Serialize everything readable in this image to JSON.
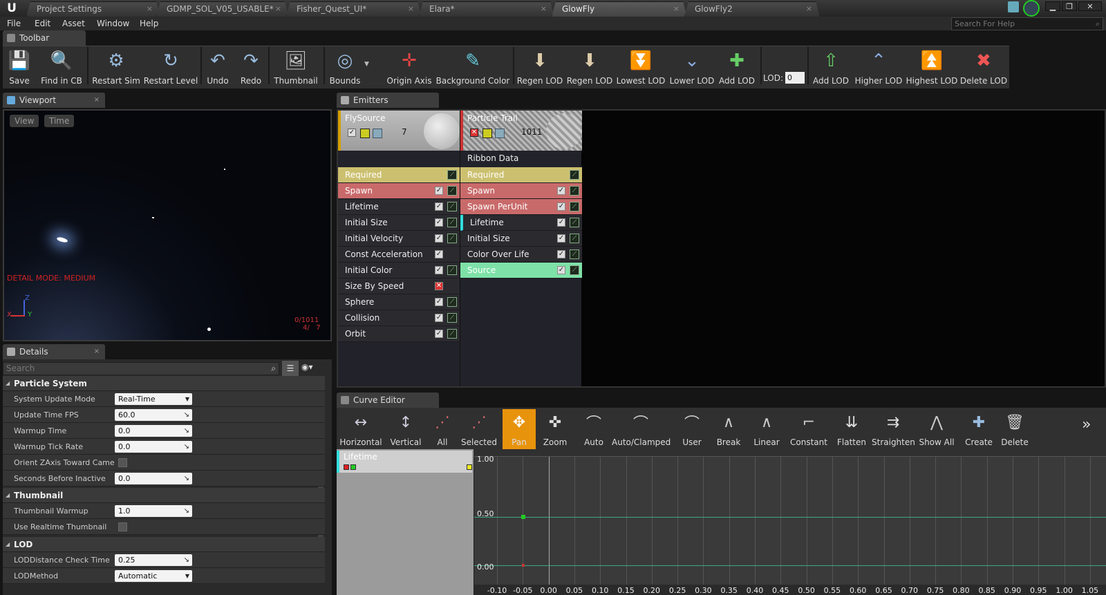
{
  "titlebar": {
    "logo": "U",
    "tabs": [
      "Project Settings",
      "GDMP_SOL_V05_USABLE*",
      "Fisher_Quest_UI*",
      "Elara*",
      "GlowFly",
      "GlowFly2"
    ],
    "close_glyph": "×"
  },
  "menu": [
    "File",
    "Edit",
    "Asset",
    "Window",
    "Help"
  ],
  "help_search_placeholder": "Search For Help",
  "toolbar": {
    "tab_label": "Toolbar",
    "buttons": [
      "Save",
      "Find in CB",
      "Restart Sim",
      "Restart Level",
      "Undo",
      "Redo",
      "Thumbnail",
      "Bounds",
      "Origin Axis",
      "Background Color",
      "Regen LOD",
      "Regen LOD",
      "Lowest LOD",
      "Lower LOD",
      "Add LOD",
      "Add LOD",
      "Higher LOD",
      "Highest LOD",
      "Delete LOD"
    ],
    "lod_label": "LOD:",
    "lod_value": "0"
  },
  "viewport": {
    "tab_label": "Viewport",
    "view_btn": "View",
    "time_btn": "Time",
    "detail_mode": "DETAIL MODE: MEDIUM",
    "counter1": "0/1011",
    "counter2": "4/   7",
    "axis_x": "X",
    "axis_y": "Y",
    "axis_z": "Z"
  },
  "details": {
    "tab_label": "Details",
    "search_placeholder": "Search",
    "cat_particle": "Particle System",
    "cat_thumb": "Thumbnail",
    "cat_lod": "LOD",
    "rows": [
      {
        "k": "System Update Mode",
        "v": "Real-Time"
      },
      {
        "k": "Update Time FPS",
        "v": "60.0"
      },
      {
        "k": "Warmup Time",
        "v": "0.0"
      },
      {
        "k": "Warmup Tick Rate",
        "v": "0.0"
      },
      {
        "k": "Orient ZAxis Toward Camera",
        "v": ""
      },
      {
        "k": "Seconds Before Inactive",
        "v": "0.0"
      },
      {
        "k": "Thumbnail Warmup",
        "v": "1.0"
      },
      {
        "k": "Use Realtime Thumbnail",
        "v": ""
      },
      {
        "k": "LODDistance Check Time",
        "v": "0.25"
      },
      {
        "k": "LODMethod",
        "v": "Automatic"
      }
    ]
  },
  "emitters": {
    "tab_label": "Emitters",
    "e1": {
      "name": "FlySource",
      "count": "7",
      "modules": [
        "Required",
        "Spawn",
        "Lifetime",
        "Initial Size",
        "Initial Velocity",
        "Const Acceleration",
        "Initial Color",
        "Size By Speed",
        "Sphere",
        "Collision",
        "Orbit"
      ]
    },
    "e2": {
      "name": "Particle Trail",
      "count": "1011",
      "type": "Ribbon Data",
      "modules": [
        "Required",
        "Spawn",
        "Spawn PerUnit",
        "Lifetime",
        "Initial Size",
        "Color Over Life",
        "Source"
      ]
    }
  },
  "curve_editor": {
    "tab_label": "Curve Editor",
    "buttons": [
      "Horizontal",
      "Vertical",
      "All",
      "Selected",
      "Pan",
      "Zoom",
      "Auto",
      "Auto/Clamped",
      "User",
      "Break",
      "Linear",
      "Constant",
      "Flatten",
      "Straighten",
      "Show All",
      "Create",
      "Delete"
    ],
    "track": "Lifetime",
    "y_ticks": [
      "1.00",
      "0.50",
      "0.00"
    ],
    "x_ticks": [
      "-0.10",
      "-0.05",
      "0.00",
      "0.05",
      "0.10",
      "0.15",
      "0.20",
      "0.25",
      "0.30",
      "0.35",
      "0.40",
      "0.45",
      "0.50",
      "0.55",
      "0.60",
      "0.65",
      "0.70",
      "0.75",
      "0.80",
      "0.85",
      "0.90",
      "0.95",
      "1.00",
      "1.05"
    ]
  },
  "colors": {
    "required": "#ccc070",
    "spawn": "#c96a6a",
    "source": "#7ee2a8",
    "pan_active": "#e8930c",
    "detail_mode": "#d22222"
  }
}
